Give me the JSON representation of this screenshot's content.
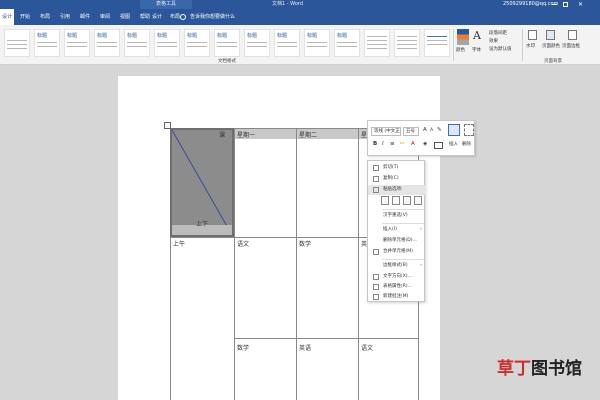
{
  "titlebar": {
    "context_tab": "表格工具",
    "doc_title": "文档1 - Word",
    "user": "2509299180@qq.com"
  },
  "tabs": [
    "设计",
    "开始",
    "布局",
    "引用",
    "邮件",
    "审阅",
    "视图",
    "帮助",
    "设计",
    "布局"
  ],
  "tell_me": "告诉我你想要做什么",
  "ribbon": {
    "styles": [
      "标题",
      "标题",
      "标题",
      "标题",
      "标题",
      "标题",
      "标题",
      "标题",
      "标题",
      "标题",
      "标题"
    ],
    "group_doc_format": "文档格式",
    "colors": "颜色",
    "fonts": "字体",
    "para_spacing": "段落间距",
    "effects": "效果",
    "set_default": "设为默认值",
    "watermark": "水印",
    "page_color": "页面颜色",
    "page_borders": "页面边框",
    "group_page_bg": "页面背景"
  },
  "table": {
    "header_corner_top": "课",
    "header_corner_bottom": "上下",
    "headers": [
      "星期一",
      "星期二",
      "星"
    ],
    "row_label": "上午",
    "row1": [
      "语文",
      "数学",
      "英"
    ],
    "row2": [
      "数学",
      "英语",
      "语文"
    ]
  },
  "minibar": {
    "font": "等线 (中文正",
    "size": "五号",
    "grow": "A",
    "shrink": "A",
    "bold": "B",
    "italic": "I",
    "insert": "插入",
    "delete": "删除"
  },
  "context_menu": {
    "cut": "剪切(T)",
    "copy": "复制(C)",
    "paste_options": "粘贴选项:",
    "reconvert": "汉字重选(V)",
    "insert": "插入(I)",
    "delete_cells": "删除单元格(D)...",
    "merge_cells": "合并单元格(M)",
    "borders": "边框样式(B)",
    "text_direction": "文字方向(X)...",
    "table_props": "表格属性(R)...",
    "new_comment": "新建批注(M)"
  },
  "watermark": {
    "part1": "草丁",
    "part2": "图书馆"
  }
}
